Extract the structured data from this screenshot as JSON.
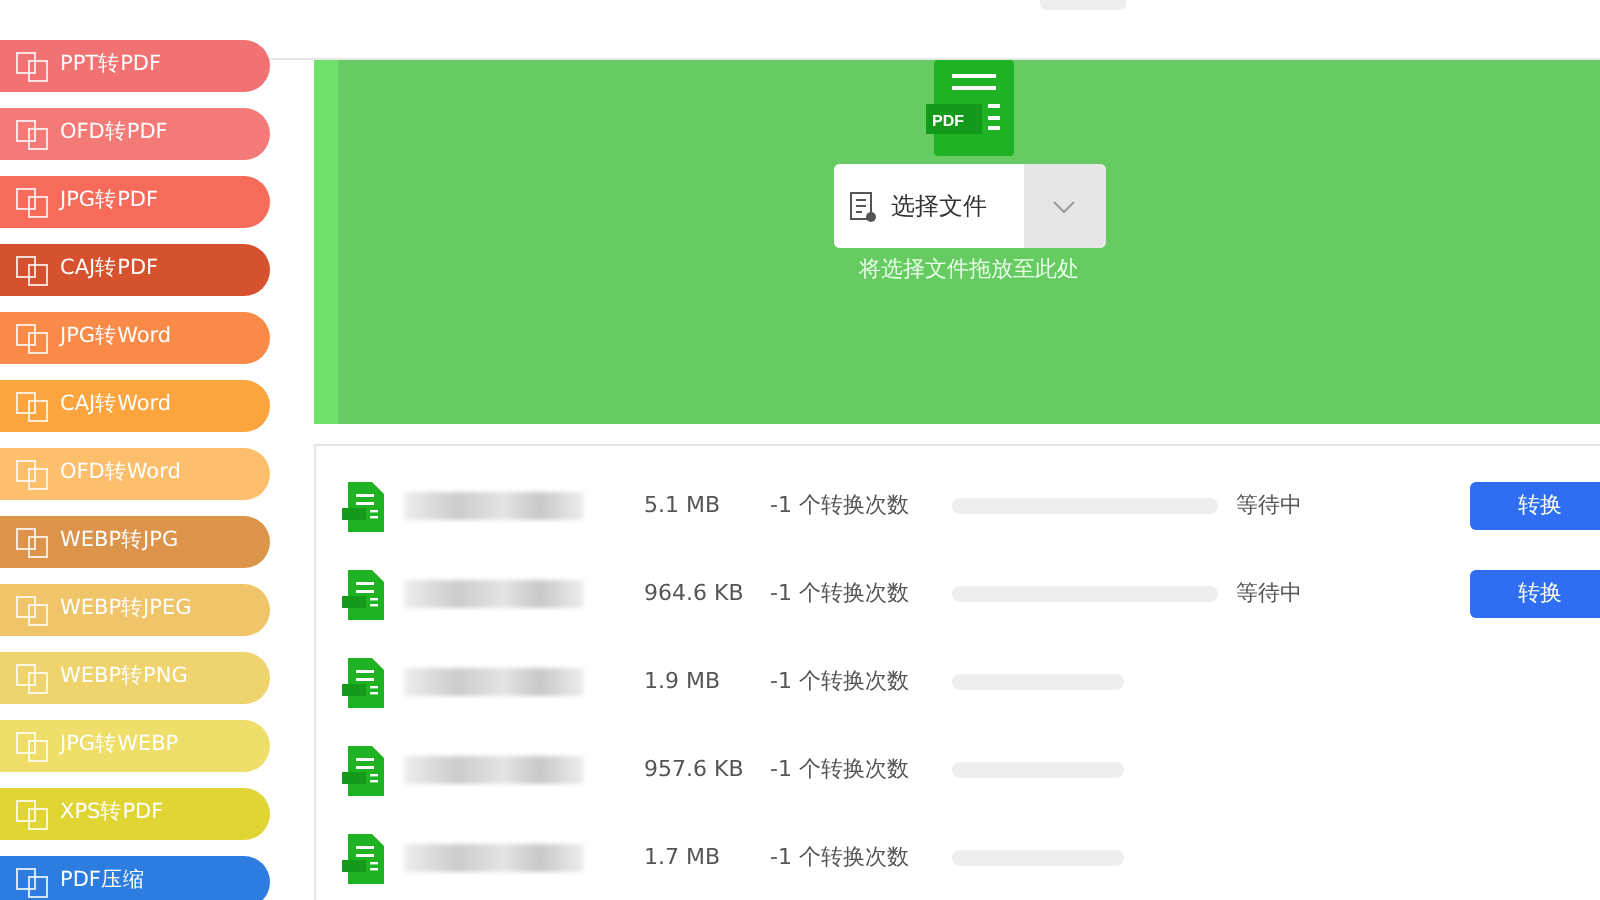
{
  "sidebar": {
    "items": [
      {
        "label": "PPT转PDF",
        "color": "#f07272"
      },
      {
        "label": "OFD转PDF",
        "color": "#f47a78"
      },
      {
        "label": "JPG转PDF",
        "color": "#f76b5b"
      },
      {
        "label": "CAJ转PDF",
        "color": "#d6512d"
      },
      {
        "label": "JPG转Word",
        "color": "#fa8a48"
      },
      {
        "label": "CAJ转Word",
        "color": "#fca43e"
      },
      {
        "label": "OFD转Word",
        "color": "#fdbf6c"
      },
      {
        "label": "WEBP转JPG",
        "color": "#dc934a"
      },
      {
        "label": "WEBP转JPEG",
        "color": "#f0c468"
      },
      {
        "label": "WEBP转PNG",
        "color": "#efd36c"
      },
      {
        "label": "JPG转WEBP",
        "color": "#efdf6a"
      },
      {
        "label": "XPS转PDF",
        "color": "#e0d535"
      },
      {
        "label": "PDF压缩",
        "color": "#2d7de0"
      }
    ]
  },
  "upload": {
    "file_badge": "PDF",
    "button": "选择文件",
    "hint": "将选择文件拖放至此处"
  },
  "files": [
    {
      "size": "5.1 MB",
      "count": "-1 个转换次数",
      "level": 0,
      "status": "等待中",
      "action": "转换"
    },
    {
      "size": "964.6 KB",
      "count": "-1 个转换次数",
      "level": 0,
      "status": "等待中",
      "action": "转换"
    },
    {
      "size": "1.9 MB",
      "count": "-1 个转换次数",
      "level": 0
    },
    {
      "size": "957.6 KB",
      "count": "-1 个转换次数",
      "level": 0
    },
    {
      "size": "1.7 MB",
      "count": "-1 个转换次数",
      "level": 0
    }
  ]
}
